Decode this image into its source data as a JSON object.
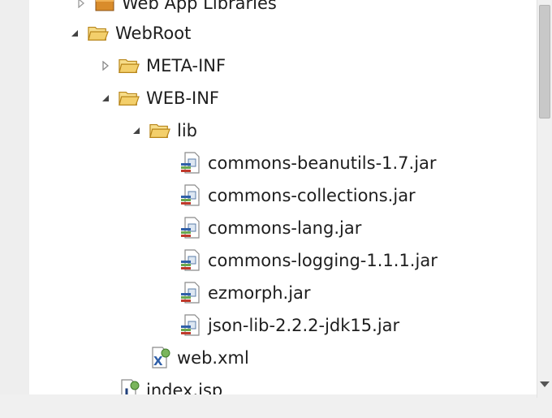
{
  "tree": {
    "partial_top_label": "Web App Libraries",
    "webroot": {
      "label": "WebRoot",
      "expanded": true,
      "icon": "open-folder-icon"
    },
    "meta_inf": {
      "label": "META-INF",
      "expanded": false,
      "icon": "open-folder-icon"
    },
    "web_inf": {
      "label": "WEB-INF",
      "expanded": true,
      "icon": "open-folder-icon"
    },
    "lib": {
      "label": "lib",
      "expanded": true,
      "icon": "open-folder-icon"
    },
    "jars": [
      {
        "label": "commons-beanutils-1.7.jar",
        "icon": "jar-file-icon"
      },
      {
        "label": "commons-collections.jar",
        "icon": "jar-file-icon"
      },
      {
        "label": "commons-lang.jar",
        "icon": "jar-file-icon"
      },
      {
        "label": "commons-logging-1.1.1.jar",
        "icon": "jar-file-icon"
      },
      {
        "label": "ezmorph.jar",
        "icon": "jar-file-icon"
      },
      {
        "label": "json-lib-2.2.2-jdk15.jar",
        "icon": "jar-file-icon"
      }
    ],
    "web_xml": {
      "label": "web.xml",
      "icon": "xml-file-icon"
    },
    "index_jsp": {
      "label": "index.jsp",
      "icon": "jsp-file-icon"
    }
  },
  "colors": {
    "folder_fill": "#f3cf6b",
    "folder_stroke": "#b8861b",
    "twisty": "#444444",
    "text": "#1e1e1e"
  }
}
